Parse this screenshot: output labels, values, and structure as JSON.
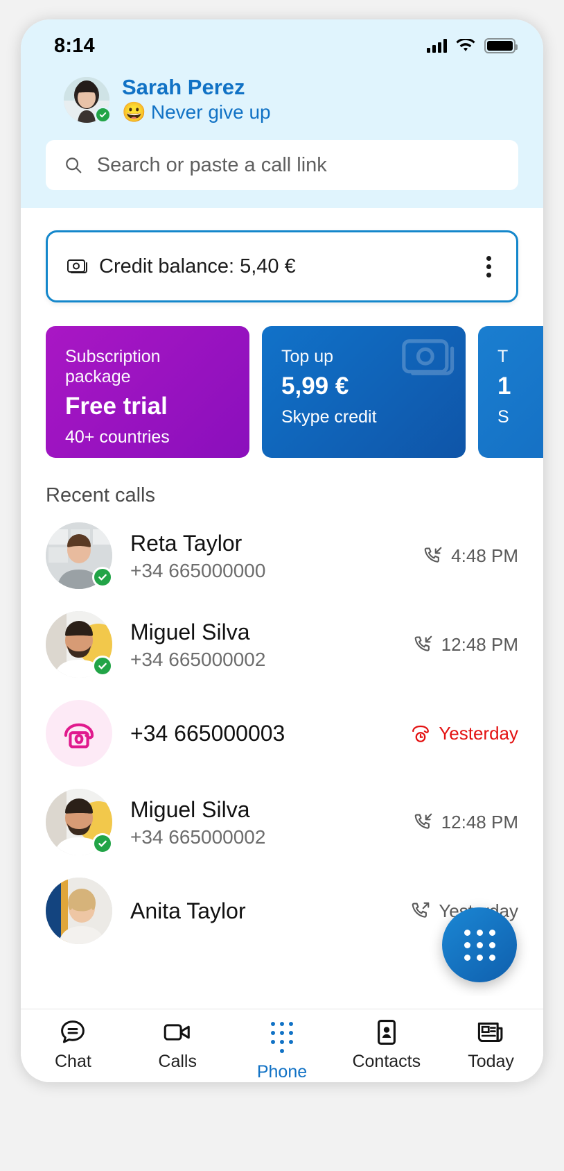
{
  "status_bar": {
    "time": "8:14",
    "signal_icon": "cellular-bars-icon",
    "wifi_icon": "wifi-icon",
    "battery_icon": "battery-full-icon"
  },
  "header": {
    "profile_name": "Sarah Perez",
    "mood_emoji": "😀",
    "mood_text": "Never give up",
    "presence": "online",
    "avatar_name": "sarah-perez-avatar"
  },
  "search": {
    "placeholder": "Search or paste a call link",
    "value": "",
    "icon": "search-icon"
  },
  "credit": {
    "label": "Credit balance: 5,40 €",
    "icon": "banknote-icon",
    "menu_icon": "more-vertical-icon",
    "border_color": "#1487cb"
  },
  "promo_cards": [
    {
      "top": "Subscription package",
      "mid": "Free trial",
      "bottom": "40+ countries",
      "color": "#8a0fbc",
      "style": "purple",
      "has_money_icon": false
    },
    {
      "top": "Top up",
      "mid": "5,99 €",
      "bottom": "Skype credit",
      "color": "#0f55a8",
      "style": "blue",
      "has_money_icon": true
    },
    {
      "top": "T",
      "mid": "1",
      "bottom": "S",
      "color": "#1268bd",
      "style": "blue",
      "has_money_icon": false
    }
  ],
  "recent_calls": {
    "section_title": "Recent calls",
    "items": [
      {
        "name": "Reta Taylor",
        "number": "+34 665000000",
        "time": "4:48 PM",
        "direction": "incoming",
        "missed": false,
        "presence": "online",
        "avatar_name": "reta-taylor-avatar"
      },
      {
        "name": "Miguel Silva",
        "number": "+34 665000002",
        "time": "12:48 PM",
        "direction": "incoming",
        "missed": false,
        "presence": "online",
        "avatar_name": "miguel-silva-avatar"
      },
      {
        "name": "+34 665000003",
        "number": "",
        "time": "Yesterday",
        "direction": "missed",
        "missed": true,
        "presence": "none",
        "avatar_name": "missed-call-avatar"
      },
      {
        "name": "Miguel Silva",
        "number": "+34 665000002",
        "time": "12:48 PM",
        "direction": "incoming",
        "missed": false,
        "presence": "online",
        "avatar_name": "miguel-silva-avatar"
      },
      {
        "name": "Anita Taylor",
        "number": "",
        "time": "Yesterday",
        "direction": "outgoing",
        "missed": false,
        "presence": "none",
        "avatar_name": "anita-taylor-avatar"
      }
    ]
  },
  "dialpad_fab": {
    "icon": "dialpad-icon",
    "color": "#0f5fad"
  },
  "tabbar": {
    "items": [
      {
        "label": "Chat",
        "icon": "chat-bubble-icon",
        "active": false
      },
      {
        "label": "Calls",
        "icon": "video-camera-icon",
        "active": false
      },
      {
        "label": "Phone",
        "icon": "dialpad-icon",
        "active": true
      },
      {
        "label": "Contacts",
        "icon": "contact-card-icon",
        "active": false
      },
      {
        "label": "Today",
        "icon": "news-icon",
        "active": false
      }
    ],
    "active_color": "#1172c5"
  }
}
